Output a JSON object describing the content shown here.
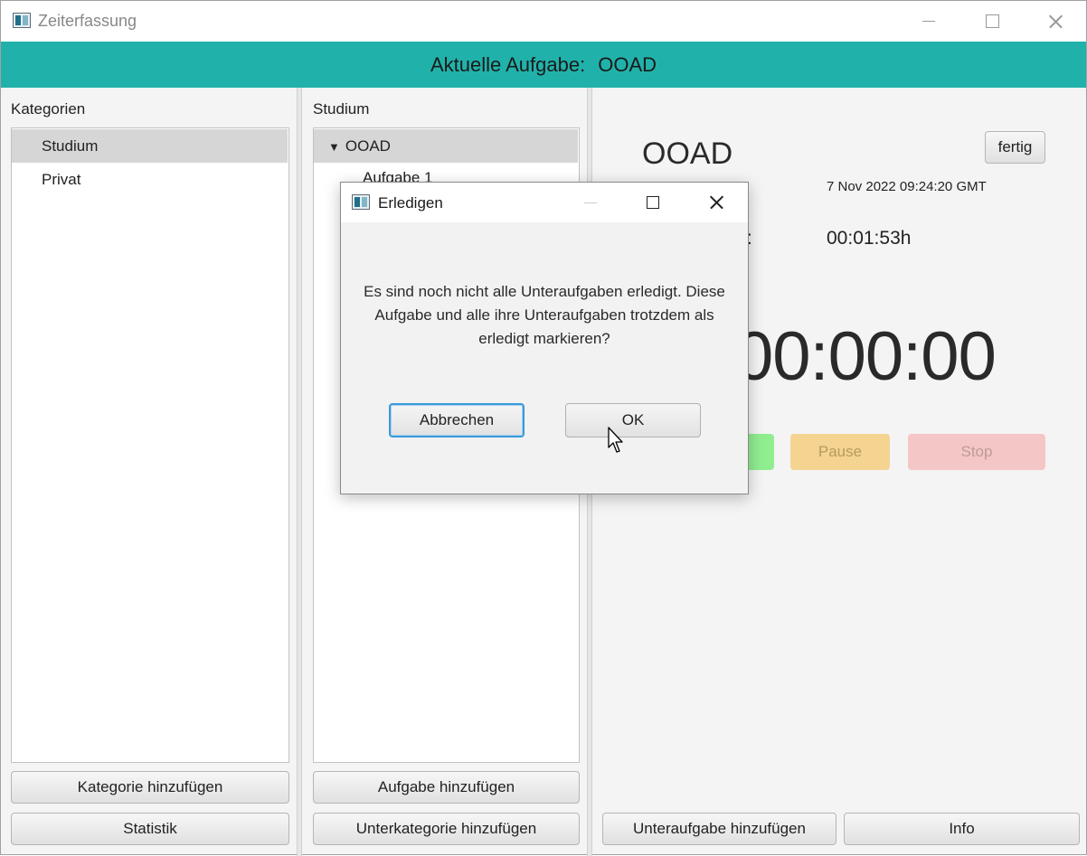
{
  "window": {
    "title": "Zeiterfassung"
  },
  "header": {
    "label": "Aktuelle Aufgabe:",
    "task": "OOAD"
  },
  "categories": {
    "title": "Kategorien",
    "items": [
      {
        "label": "Studium",
        "selected": true
      },
      {
        "label": "Privat",
        "selected": false
      }
    ],
    "add_button": "Kategorie hinzufügen",
    "stats_button": "Statistik"
  },
  "tasks": {
    "title": "Studium",
    "tree": {
      "node": "OOAD",
      "expanded_symbol": "▼",
      "child": "Aufgabe 1"
    },
    "add_button": "Aufgabe hinzufügen",
    "sub_category_button": "Unterkategorie hinzufügen"
  },
  "details": {
    "task_name": "OOAD",
    "done_button": "fertig",
    "start_date": "7 Nov 2022 09:24:20 GMT",
    "duration_colon": ":",
    "duration": "00:01:53h",
    "timer": "00:00:00",
    "pause_label": "Pause",
    "stop_label": "Stop",
    "add_subtask_button": "Unteraufgabe hinzufügen",
    "info_button": "Info",
    "colors": {
      "start": "#90ee90",
      "pause": "#f5d492",
      "stop": "#f5c6c6"
    }
  },
  "dialog": {
    "title": "Erledigen",
    "message": "Es sind noch nicht alle Unteraufgaben erledigt. Diese Aufgabe und alle ihre Unteraufgaben trotzdem als erledigt markieren?",
    "cancel": "Abbrechen",
    "ok": "OK"
  },
  "colors": {
    "accent": "#20b2aa"
  }
}
